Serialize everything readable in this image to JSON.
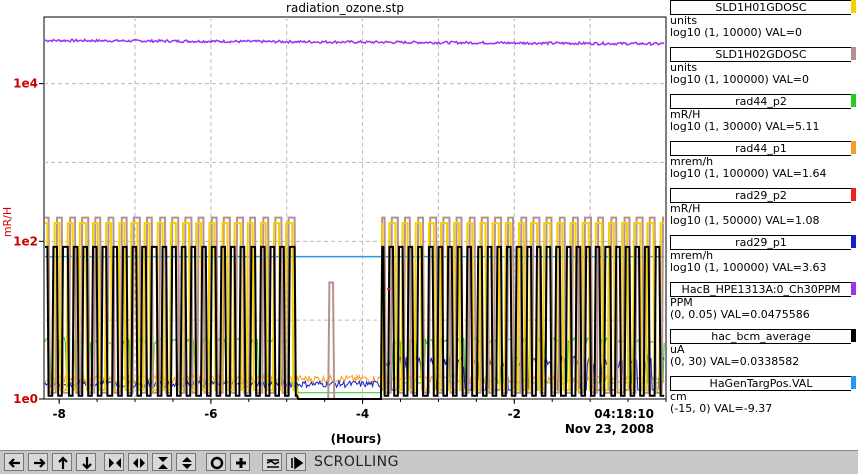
{
  "chart_data": {
    "type": "line",
    "title": "radiation_ozone.stp",
    "xlabel": "(Hours)",
    "ylabel": "mR/H",
    "y_scale": "log",
    "xlim": [
      -8.2,
      0
    ],
    "ylim": [
      1,
      70000
    ],
    "x_ticks": [
      "-8",
      "-6",
      "-4",
      "-2"
    ],
    "y_ticks": [
      "1e0",
      "1e2",
      "1e4"
    ],
    "time_label": "04:18:10",
    "date_label": "Nov 23, 2008",
    "grid": true,
    "legend_placement": "right",
    "series": [
      {
        "name": "SLD1H01GDOSC",
        "unit": "units",
        "range": "log10 (1, 10000) VAL=0",
        "color": "#f5d000"
      },
      {
        "name": "SLD1H02GDOSC",
        "unit": "units",
        "range": "log10 (1, 100000) VAL=0",
        "color": "#b89090"
      },
      {
        "name": "rad44_p2",
        "unit": "mR/H",
        "range": "log10 (1, 30000) VAL=5.11",
        "color": "#22cc22"
      },
      {
        "name": "rad44_p1",
        "unit": "mrem/h",
        "range": "log10 (1, 100000) VAL=1.64",
        "color": "#f5a020"
      },
      {
        "name": "rad29_p2",
        "unit": "mR/H",
        "range": "log10 (1, 50000) VAL=1.08",
        "color": "#ee2020"
      },
      {
        "name": "rad29_p1",
        "unit": "mrem/h",
        "range": "log10 (1, 100000) VAL=3.63",
        "color": "#1020cc"
      },
      {
        "name": "HacB_HPE1313A:0_Ch30PPM",
        "unit": "PPM",
        "range": "(0, 0.05) VAL=0.0475586",
        "color": "#9933ee"
      },
      {
        "name": "hac_bcm_average",
        "unit": "uA",
        "range": "(0, 30) VAL=0.0338582",
        "color": "#000000"
      },
      {
        "name": "HaGenTargPos.VAL",
        "unit": "cm",
        "range": "(-15, 0) VAL=-9.37",
        "color": "#2299ee"
      }
    ]
  },
  "toolbar": {
    "buttons": [
      "arrow-left-icon",
      "arrow-right-icon",
      "arrow-up-icon",
      "arrow-down-icon",
      "expand-horizontal-icon",
      "compress-horizontal-icon",
      "expand-vertical-icon",
      "compress-vertical-icon",
      "record-icon",
      "plus-icon",
      "fit-icon",
      "pause-icon"
    ],
    "status": "SCROLLING"
  }
}
